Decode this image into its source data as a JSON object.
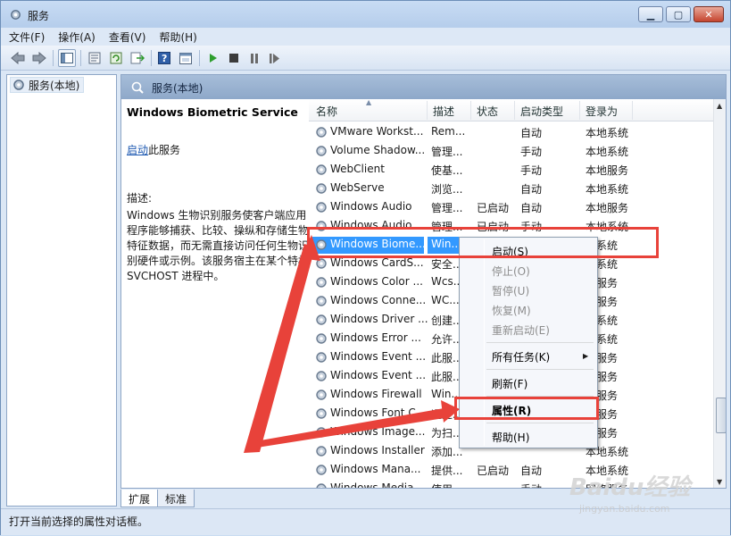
{
  "window": {
    "title": "服务",
    "min_icon": "minimize-icon",
    "max_icon": "maximize-icon",
    "close_icon": "close-icon"
  },
  "menu": [
    "文件(F)",
    "操作(A)",
    "查看(V)",
    "帮助(H)"
  ],
  "toolbar": [
    "back-icon",
    "forward-icon",
    "show-tree-icon",
    "properties-icon",
    "refresh-icon",
    "export-icon",
    "help-icon",
    "console-icon",
    "play-icon",
    "stop-icon",
    "pause-icon",
    "restart-icon"
  ],
  "tree": {
    "root": "服务(本地)"
  },
  "content": {
    "header": "服务(本地)",
    "service_name": "Windows Biometric Service",
    "start_link": "启动",
    "start_suffix": "此服务",
    "desc_label": "描述:",
    "desc_text": "Windows 生物识别服务使客户端应用程序能够捕获、比较、操纵和存储生物特征数据，而无需直接访问任何生物识别硬件或示例。该服务宿主在某个特权 SVCHOST 进程中。"
  },
  "columns": [
    "名称",
    "描述",
    "状态",
    "启动类型",
    "登录为"
  ],
  "rows": [
    {
      "name": "VMware Workst...",
      "desc": "Rem...",
      "state": "",
      "start": "自动",
      "logon": "本地系统"
    },
    {
      "name": "Volume Shadow...",
      "desc": "管理...",
      "state": "",
      "start": "手动",
      "logon": "本地系统"
    },
    {
      "name": "WebClient",
      "desc": "使基...",
      "state": "",
      "start": "手动",
      "logon": "本地服务"
    },
    {
      "name": "WebServe",
      "desc": "浏览...",
      "state": "",
      "start": "自动",
      "logon": "本地系统"
    },
    {
      "name": "Windows Audio",
      "desc": "管理...",
      "state": "已启动",
      "start": "自动",
      "logon": "本地服务"
    },
    {
      "name": "Windows Audio...",
      "desc": "管理...",
      "state": "已启动",
      "start": "手动",
      "logon": "本地系统"
    },
    {
      "name": "Windows Biome...",
      "desc": "Win...",
      "state": "",
      "start": "",
      "logon": "地系统"
    },
    {
      "name": "Windows CardS...",
      "desc": "安全...",
      "state": "",
      "start": "",
      "logon": "地系统"
    },
    {
      "name": "Windows Color ...",
      "desc": "Wcs...",
      "state": "",
      "start": "",
      "logon": "地服务"
    },
    {
      "name": "Windows Conne...",
      "desc": "WC...",
      "state": "",
      "start": "",
      "logon": "地服务"
    },
    {
      "name": "Windows Driver ...",
      "desc": "创建...",
      "state": "",
      "start": "",
      "logon": "地系统"
    },
    {
      "name": "Windows Error ...",
      "desc": "允许...",
      "state": "",
      "start": "",
      "logon": "地系统"
    },
    {
      "name": "Windows Event ...",
      "desc": "此服...",
      "state": "",
      "start": "",
      "logon": "络服务"
    },
    {
      "name": "Windows Event ...",
      "desc": "此服...",
      "state": "",
      "start": "",
      "logon": "地服务"
    },
    {
      "name": "Windows Firewall",
      "desc": "Win...",
      "state": "",
      "start": "",
      "logon": "地服务"
    },
    {
      "name": "Windows Font C...",
      "desc": "通过...",
      "state": "",
      "start": "",
      "logon": "地服务"
    },
    {
      "name": "Windows Image...",
      "desc": "为扫...",
      "state": "",
      "start": "",
      "logon": "地服务"
    },
    {
      "name": "Windows Installer",
      "desc": "添加...",
      "state": "",
      "start": "",
      "logon": "本地系统"
    },
    {
      "name": "Windows Mana...",
      "desc": "提供...",
      "state": "已启动",
      "start": "自动",
      "logon": "本地系统"
    },
    {
      "name": "Windows Media...",
      "desc": "使用...",
      "state": "",
      "start": "手动",
      "logon": "网络服务"
    }
  ],
  "context_menu": {
    "start": "启动(S)",
    "stop": "停止(O)",
    "pause": "暂停(U)",
    "resume": "恢复(M)",
    "restart": "重新启动(E)",
    "all_tasks": "所有任务(K)",
    "refresh": "刷新(F)",
    "properties": "属性(R)",
    "help": "帮助(H)"
  },
  "tabs": [
    "扩展",
    "标准"
  ],
  "status": "打开当前选择的属性对话框。",
  "watermark": {
    "main": "Baidu经验",
    "sub": "jingyan.baidu.com"
  },
  "colors": {
    "selection": "#3399ff",
    "annotation": "#e8423a",
    "link": "#1b57b0"
  }
}
